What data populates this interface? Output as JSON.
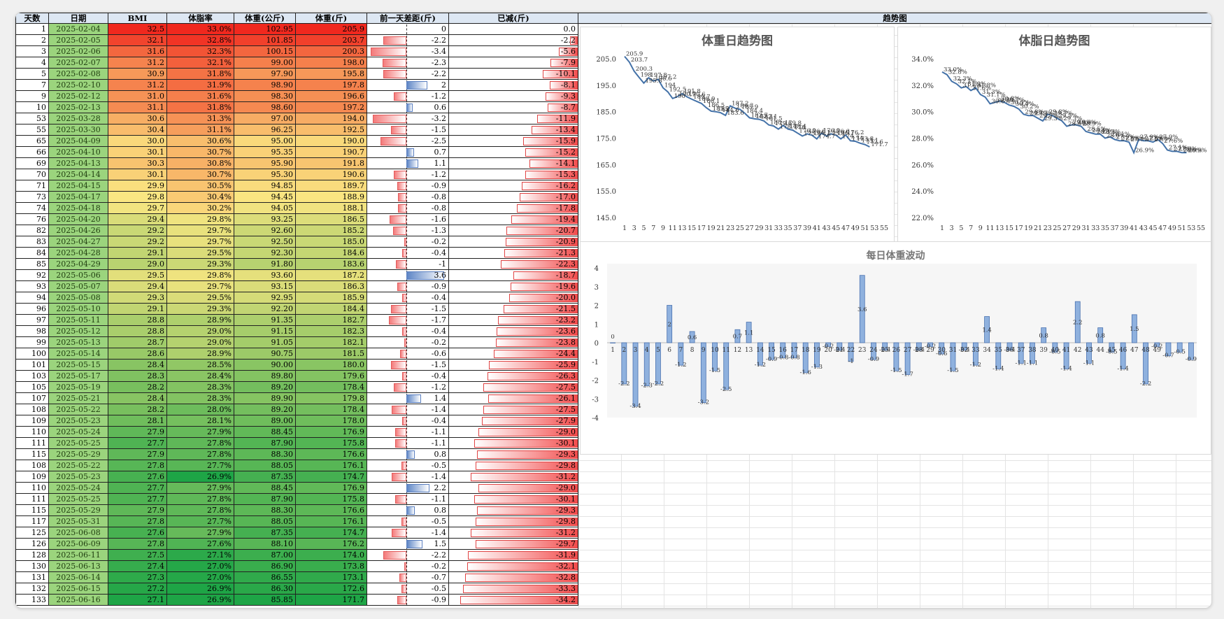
{
  "headers": {
    "day": "天数",
    "date": "日期",
    "bmi": "BMI",
    "fat": "体脂率",
    "kg": "体重(公斤)",
    "jin": "体重(斤)",
    "diff": "前一天差距(斤)",
    "lost": "已减(斤)",
    "trend": "趋势图"
  },
  "rows": [
    {
      "day": "1",
      "date": "2025-02-04",
      "bmi": "32.5",
      "fat": "33.0%",
      "kg": "102.95",
      "jin": "205.9",
      "diff": "0",
      "lost": "0.0"
    },
    {
      "day": "2",
      "date": "2025-02-05",
      "bmi": "32.1",
      "fat": "32.8%",
      "kg": "101.85",
      "jin": "203.7",
      "diff": "-2.2",
      "lost": "-2.2"
    },
    {
      "day": "3",
      "date": "2025-02-06",
      "bmi": "31.6",
      "fat": "32.3%",
      "kg": "100.15",
      "jin": "200.3",
      "diff": "-3.4",
      "lost": "-5.6"
    },
    {
      "day": "4",
      "date": "2025-02-07",
      "bmi": "31.2",
      "fat": "32.1%",
      "kg": "99.00",
      "jin": "198.0",
      "diff": "-2.3",
      "lost": "-7.9"
    },
    {
      "day": "5",
      "date": "2025-02-08",
      "bmi": "30.9",
      "fat": "31.8%",
      "kg": "97.90",
      "jin": "195.8",
      "diff": "-2.2",
      "lost": "-10.1"
    },
    {
      "day": "7",
      "date": "2025-02-10",
      "bmi": "31.2",
      "fat": "31.9%",
      "kg": "98.90",
      "jin": "197.8",
      "diff": "2",
      "lost": "-8.1"
    },
    {
      "day": "9",
      "date": "2025-02-12",
      "bmi": "31.0",
      "fat": "31.6%",
      "kg": "98.30",
      "jin": "196.6",
      "diff": "-1.2",
      "lost": "-9.3"
    },
    {
      "day": "10",
      "date": "2025-02-13",
      "bmi": "31.1",
      "fat": "31.8%",
      "kg": "98.60",
      "jin": "197.2",
      "diff": "0.6",
      "lost": "-8.7"
    },
    {
      "day": "53",
      "date": "2025-03-28",
      "bmi": "30.6",
      "fat": "31.3%",
      "kg": "97.00",
      "jin": "194.0",
      "diff": "-3.2",
      "lost": "-11.9"
    },
    {
      "day": "55",
      "date": "2025-03-30",
      "bmi": "30.4",
      "fat": "31.1%",
      "kg": "96.25",
      "jin": "192.5",
      "diff": "-1.5",
      "lost": "-13.4"
    },
    {
      "day": "65",
      "date": "2025-04-09",
      "bmi": "30.0",
      "fat": "30.6%",
      "kg": "95.00",
      "jin": "190.0",
      "diff": "-2.5",
      "lost": "-15.9"
    },
    {
      "day": "66",
      "date": "2025-04-10",
      "bmi": "30.1",
      "fat": "30.7%",
      "kg": "95.35",
      "jin": "190.7",
      "diff": "0.7",
      "lost": "-15.2"
    },
    {
      "day": "69",
      "date": "2025-04-13",
      "bmi": "30.3",
      "fat": "30.8%",
      "kg": "95.90",
      "jin": "191.8",
      "diff": "1.1",
      "lost": "-14.1"
    },
    {
      "day": "70",
      "date": "2025-04-14",
      "bmi": "30.1",
      "fat": "30.7%",
      "kg": "95.30",
      "jin": "190.6",
      "diff": "-1.2",
      "lost": "-15.3"
    },
    {
      "day": "71",
      "date": "2025-04-15",
      "bmi": "29.9",
      "fat": "30.5%",
      "kg": "94.85",
      "jin": "189.7",
      "diff": "-0.9",
      "lost": "-16.2"
    },
    {
      "day": "73",
      "date": "2025-04-17",
      "bmi": "29.8",
      "fat": "30.4%",
      "kg": "94.45",
      "jin": "188.9",
      "diff": "-0.8",
      "lost": "-17.0"
    },
    {
      "day": "74",
      "date": "2025-04-18",
      "bmi": "29.7",
      "fat": "30.2%",
      "kg": "94.05",
      "jin": "188.1",
      "diff": "-0.8",
      "lost": "-17.8"
    },
    {
      "day": "76",
      "date": "2025-04-20",
      "bmi": "29.4",
      "fat": "29.8%",
      "kg": "93.25",
      "jin": "186.5",
      "diff": "-1.6",
      "lost": "-19.4"
    },
    {
      "day": "82",
      "date": "2025-04-26",
      "bmi": "29.2",
      "fat": "29.7%",
      "kg": "92.60",
      "jin": "185.2",
      "diff": "-1.3",
      "lost": "-20.7"
    },
    {
      "day": "83",
      "date": "2025-04-27",
      "bmi": "29.2",
      "fat": "29.7%",
      "kg": "92.50",
      "jin": "185.0",
      "diff": "-0.2",
      "lost": "-20.9"
    },
    {
      "day": "84",
      "date": "2025-04-28",
      "bmi": "29.1",
      "fat": "29.5%",
      "kg": "92.30",
      "jin": "184.6",
      "diff": "-0.4",
      "lost": "-21.3"
    },
    {
      "day": "85",
      "date": "2025-04-29",
      "bmi": "29.0",
      "fat": "29.3%",
      "kg": "91.80",
      "jin": "183.6",
      "diff": "-1",
      "lost": "-22.3"
    },
    {
      "day": "92",
      "date": "2025-05-06",
      "bmi": "29.5",
      "fat": "29.8%",
      "kg": "93.60",
      "jin": "187.2",
      "diff": "3.6",
      "lost": "-18.7"
    },
    {
      "day": "93",
      "date": "2025-05-07",
      "bmi": "29.4",
      "fat": "29.7%",
      "kg": "93.15",
      "jin": "186.3",
      "diff": "-0.9",
      "lost": "-19.6"
    },
    {
      "day": "94",
      "date": "2025-05-08",
      "bmi": "29.3",
      "fat": "29.5%",
      "kg": "92.95",
      "jin": "185.9",
      "diff": "-0.4",
      "lost": "-20.0"
    },
    {
      "day": "96",
      "date": "2025-05-10",
      "bmi": "29.1",
      "fat": "29.3%",
      "kg": "92.20",
      "jin": "184.4",
      "diff": "-1.5",
      "lost": "-21.5"
    },
    {
      "day": "97",
      "date": "2025-05-11",
      "bmi": "28.8",
      "fat": "28.9%",
      "kg": "91.35",
      "jin": "182.7",
      "diff": "-1.7",
      "lost": "-23.2"
    },
    {
      "day": "98",
      "date": "2025-05-12",
      "bmi": "28.8",
      "fat": "29.0%",
      "kg": "91.15",
      "jin": "182.3",
      "diff": "-0.4",
      "lost": "-23.6"
    },
    {
      "day": "99",
      "date": "2025-05-13",
      "bmi": "28.7",
      "fat": "29.0%",
      "kg": "91.05",
      "jin": "182.1",
      "diff": "-0.2",
      "lost": "-23.8"
    },
    {
      "day": "100",
      "date": "2025-05-14",
      "bmi": "28.6",
      "fat": "28.9%",
      "kg": "90.75",
      "jin": "181.5",
      "diff": "-0.6",
      "lost": "-24.4"
    },
    {
      "day": "101",
      "date": "2025-05-15",
      "bmi": "28.4",
      "fat": "28.5%",
      "kg": "90.00",
      "jin": "180.0",
      "diff": "-1.5",
      "lost": "-25.9"
    },
    {
      "day": "103",
      "date": "2025-05-17",
      "bmi": "28.3",
      "fat": "28.4%",
      "kg": "89.80",
      "jin": "179.6",
      "diff": "-0.4",
      "lost": "-26.3"
    },
    {
      "day": "105",
      "date": "2025-05-19",
      "bmi": "28.2",
      "fat": "28.3%",
      "kg": "89.20",
      "jin": "178.4",
      "diff": "-1.2",
      "lost": "-27.5"
    },
    {
      "day": "107",
      "date": "2025-05-21",
      "bmi": "28.4",
      "fat": "28.3%",
      "kg": "89.90",
      "jin": "179.8",
      "diff": "1.4",
      "lost": "-26.1"
    },
    {
      "day": "108",
      "date": "2025-05-22",
      "bmi": "28.2",
      "fat": "28.0%",
      "kg": "89.20",
      "jin": "178.4",
      "diff": "-1.4",
      "lost": "-27.5"
    },
    {
      "day": "109",
      "date": "2025-05-23",
      "bmi": "28.1",
      "fat": "28.1%",
      "kg": "89.00",
      "jin": "178.0",
      "diff": "-0.4",
      "lost": "-27.9"
    },
    {
      "day": "110",
      "date": "2025-05-24",
      "bmi": "27.9",
      "fat": "27.9%",
      "kg": "88.45",
      "jin": "176.9",
      "diff": "-1.1",
      "lost": "-29.0"
    },
    {
      "day": "111",
      "date": "2025-05-25",
      "bmi": "27.7",
      "fat": "27.8%",
      "kg": "87.90",
      "jin": "175.8",
      "diff": "-1.1",
      "lost": "-30.1"
    },
    {
      "day": "115",
      "date": "2025-05-29",
      "bmi": "27.9",
      "fat": "27.8%",
      "kg": "88.30",
      "jin": "176.6",
      "diff": "0.8",
      "lost": "-29.3"
    },
    {
      "day": "108",
      "date": "2025-05-22",
      "bmi": "27.8",
      "fat": "27.7%",
      "kg": "88.05",
      "jin": "176.1",
      "diff": "-0.5",
      "lost": "-29.8"
    },
    {
      "day": "109",
      "date": "2025-05-23",
      "bmi": "27.6",
      "fat": "26.9%",
      "kg": "87.35",
      "jin": "174.7",
      "diff": "-1.4",
      "lost": "-31.2"
    },
    {
      "day": "110",
      "date": "2025-05-24",
      "bmi": "27.7",
      "fat": "27.9%",
      "kg": "88.45",
      "jin": "176.9",
      "diff": "2.2",
      "lost": "-29.0"
    },
    {
      "day": "111",
      "date": "2025-05-25",
      "bmi": "27.7",
      "fat": "27.8%",
      "kg": "87.90",
      "jin": "175.8",
      "diff": "-1.1",
      "lost": "-30.1"
    },
    {
      "day": "115",
      "date": "2025-05-29",
      "bmi": "27.9",
      "fat": "27.8%",
      "kg": "88.30",
      "jin": "176.6",
      "diff": "0.8",
      "lost": "-29.3"
    },
    {
      "day": "117",
      "date": "2025-05-31",
      "bmi": "27.8",
      "fat": "27.7%",
      "kg": "88.05",
      "jin": "176.1",
      "diff": "-0.5",
      "lost": "-29.8"
    },
    {
      "day": "125",
      "date": "2025-06-08",
      "bmi": "27.6",
      "fat": "27.9%",
      "kg": "87.35",
      "jin": "174.7",
      "diff": "-1.4",
      "lost": "-31.2"
    },
    {
      "day": "126",
      "date": "2025-06-09",
      "bmi": "27.8",
      "fat": "27.6%",
      "kg": "88.10",
      "jin": "176.2",
      "diff": "1.5",
      "lost": "-29.7"
    },
    {
      "day": "128",
      "date": "2025-06-11",
      "bmi": "27.5",
      "fat": "27.1%",
      "kg": "87.00",
      "jin": "174.0",
      "diff": "-2.2",
      "lost": "-31.9"
    },
    {
      "day": "130",
      "date": "2025-06-13",
      "bmi": "27.4",
      "fat": "27.0%",
      "kg": "86.90",
      "jin": "173.8",
      "diff": "-0.2",
      "lost": "-32.1"
    },
    {
      "day": "131",
      "date": "2025-06-14",
      "bmi": "27.3",
      "fat": "27.0%",
      "kg": "86.55",
      "jin": "173.1",
      "diff": "-0.7",
      "lost": "-32.8"
    },
    {
      "day": "132",
      "date": "2025-06-15",
      "bmi": "27.2",
      "fat": "26.9%",
      "kg": "86.30",
      "jin": "172.6",
      "diff": "-0.5",
      "lost": "-33.3"
    },
    {
      "day": "133",
      "date": "2025-06-16",
      "bmi": "27.1",
      "fat": "26.9%",
      "kg": "85.85",
      "jin": "171.7",
      "diff": "-0.9",
      "lost": "-34.2"
    }
  ],
  "chart_data": [
    {
      "type": "line",
      "title": "体重日趋势图",
      "x": [
        1,
        2,
        3,
        4,
        5,
        6,
        7,
        8,
        9,
        10,
        11,
        12,
        13,
        14,
        15,
        16,
        17,
        18,
        19,
        20,
        21,
        22,
        23,
        24,
        25,
        26,
        27,
        28,
        29,
        30,
        31,
        32,
        33,
        34,
        35,
        36,
        37,
        38,
        39,
        40,
        41,
        42,
        43,
        44,
        45,
        46,
        47,
        48,
        49,
        50,
        51,
        52,
        53,
        54,
        55
      ],
      "values": [
        205.9,
        203.7,
        200.3,
        198.0,
        195.8,
        197.8,
        196.6,
        197.2,
        194.0,
        192.5,
        190.0,
        190.7,
        191.8,
        190.6,
        189.7,
        188.9,
        188.1,
        186.5,
        185.2,
        185.0,
        184.6,
        183.6,
        187.2,
        186.3,
        185.9,
        184.4,
        182.7,
        182.3,
        182.1,
        181.5,
        180.0,
        179.6,
        178.4,
        179.8,
        178.4,
        178.0,
        176.9,
        175.8,
        176.6,
        176.1,
        174.7,
        176.9,
        175.8,
        176.6,
        176.1,
        174.7,
        176.2,
        174.0,
        173.8,
        173.1,
        172.6,
        171.7
      ],
      "ylim": [
        145,
        205
      ],
      "yticks": [
        "145.0",
        "155.0",
        "165.0",
        "175.0",
        "185.0",
        "195.0",
        "205.0"
      ],
      "xticks": [
        "1",
        "3",
        "5",
        "7",
        "9",
        "11",
        "13",
        "15",
        "17",
        "19",
        "21",
        "23",
        "25",
        "27",
        "29",
        "31",
        "33",
        "35",
        "37",
        "39",
        "41",
        "43",
        "45",
        "47",
        "49",
        "51",
        "53",
        "55"
      ]
    },
    {
      "type": "line",
      "title": "体脂日趋势图",
      "values": [
        33.0,
        32.8,
        32.3,
        32.1,
        31.8,
        31.9,
        31.6,
        31.8,
        31.3,
        31.1,
        30.6,
        30.7,
        30.8,
        30.7,
        30.5,
        30.4,
        30.2,
        29.8,
        29.7,
        29.7,
        29.5,
        29.3,
        29.8,
        29.7,
        29.5,
        29.3,
        28.9,
        29.0,
        29.0,
        28.9,
        28.5,
        28.4,
        28.3,
        28.3,
        28.0,
        28.1,
        27.9,
        27.8,
        27.8,
        27.7,
        26.9,
        27.9,
        27.8,
        27.8,
        27.7,
        27.9,
        27.6,
        27.1,
        27.0,
        27.0,
        26.9,
        26.9
      ],
      "labels": [
        "33.0%",
        "32.8%",
        "32.3%",
        "32.1%",
        "31.8%",
        "31.9%",
        "31.6%",
        "31.8%",
        "31.3%",
        "31.1%",
        "30.6%",
        "30.7%",
        "30.8%",
        "30.7%",
        "30.5%",
        "30.4%",
        "30.2%",
        "29.8%",
        "29.7%",
        "29.7%",
        "29.5%",
        "29.3%",
        "29.8%",
        "29.7%",
        "29.5%",
        "29.3%",
        "28.9%",
        "29.0%",
        "29.0%",
        "28.9%",
        "28.5%",
        "28.4%",
        "28.3%",
        "28.3%",
        "28.0%",
        "28.1%",
        "27.9%",
        "27.8%",
        "27.8%",
        "27.7%",
        "26.9%",
        "27.9%",
        "27.8%",
        "27.8%",
        "27.7%",
        "27.9%",
        "27.6%",
        "27.1%",
        "27.0%",
        "27.0%",
        "26.9%",
        "26.9%"
      ],
      "ylim": [
        22,
        34
      ],
      "yticks": [
        "22.0%",
        "24.0%",
        "26.0%",
        "28.0%",
        "30.0%",
        "32.0%",
        "34.0%"
      ],
      "xticks": [
        "1",
        "3",
        "5",
        "7",
        "9",
        "11",
        "13",
        "15",
        "17",
        "19",
        "21",
        "23",
        "25",
        "27",
        "29",
        "31",
        "33",
        "35",
        "37",
        "39",
        "41",
        "43",
        "45",
        "47",
        "49",
        "51",
        "53",
        "55"
      ]
    },
    {
      "type": "bar",
      "title": "每日体重波动",
      "categories": [
        "1",
        "2",
        "3",
        "4",
        "5",
        "6",
        "7",
        "8",
        "9",
        "10",
        "11",
        "12",
        "13",
        "14",
        "15",
        "16",
        "17",
        "18",
        "19",
        "20",
        "21",
        "22",
        "23",
        "24",
        "25",
        "26",
        "27",
        "28",
        "29",
        "30",
        "31",
        "32",
        "33",
        "34",
        "35",
        "36",
        "37",
        "38",
        "39",
        "40",
        "41",
        "42",
        "43",
        "44",
        "45",
        "46",
        "47",
        "48",
        "49",
        "50",
        "51",
        "52"
      ],
      "values": [
        0,
        -2.2,
        -3.4,
        -2.3,
        -2.2,
        2,
        -1.2,
        0.6,
        -3.2,
        -1.5,
        -2.5,
        0.7,
        1.1,
        -1.2,
        -0.9,
        -0.8,
        -0.8,
        -1.6,
        -1.3,
        -0.2,
        -0.4,
        -1,
        3.6,
        -0.9,
        -0.4,
        -1.5,
        -1.7,
        -0.4,
        -0.2,
        -0.6,
        -1.5,
        -0.4,
        -1.2,
        1.4,
        -1.4,
        -0.4,
        -1.1,
        -1.1,
        0.8,
        -0.5,
        -1.4,
        2.2,
        -1.1,
        0.8,
        -0.5,
        -1.4,
        1.5,
        -2.2,
        -0.2,
        -0.7,
        -0.5,
        -0.9
      ],
      "ylim": [
        -4,
        4
      ],
      "yticks": [
        "-4",
        "-3",
        "-2",
        "-1",
        "0",
        "1",
        "2",
        "3",
        "4"
      ],
      "xticks": [
        "1",
        "2",
        "3",
        "4",
        "5",
        "6",
        "7",
        "8",
        "9",
        "10",
        "11",
        "12",
        "13",
        "14",
        "15",
        "16",
        "17",
        "18",
        "19",
        "20",
        "21",
        "22",
        "23",
        "24",
        "25",
        "26",
        "27",
        "28",
        "29",
        "30",
        "31",
        "32",
        "33",
        "34",
        "35",
        "36",
        "37",
        "38",
        "39",
        "40",
        "41",
        "42",
        "43",
        "44",
        "45",
        "46",
        "47",
        "48",
        "49"
      ]
    }
  ]
}
